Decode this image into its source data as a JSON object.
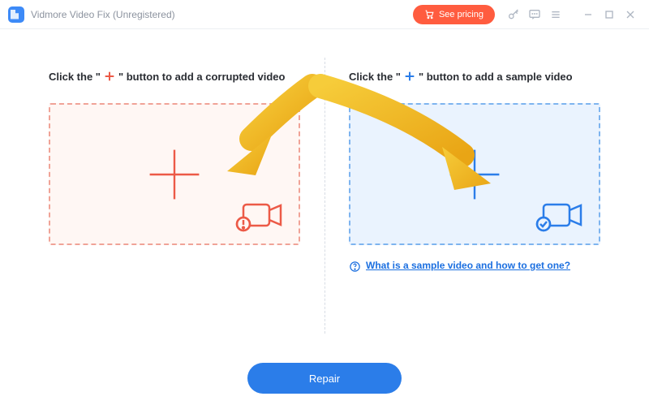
{
  "titlebar": {
    "app_name": "Vidmore Video Fix (Unregistered)",
    "see_pricing_label": "See pricing"
  },
  "left_panel": {
    "instruction_prefix": "Click the \"",
    "instruction_suffix": "\" button to add a corrupted video"
  },
  "right_panel": {
    "instruction_prefix": "Click the \"",
    "instruction_suffix": "\" button to add a sample video",
    "help_text": "What is a sample video and how to get one?"
  },
  "footer": {
    "repair_label": "Repair"
  }
}
